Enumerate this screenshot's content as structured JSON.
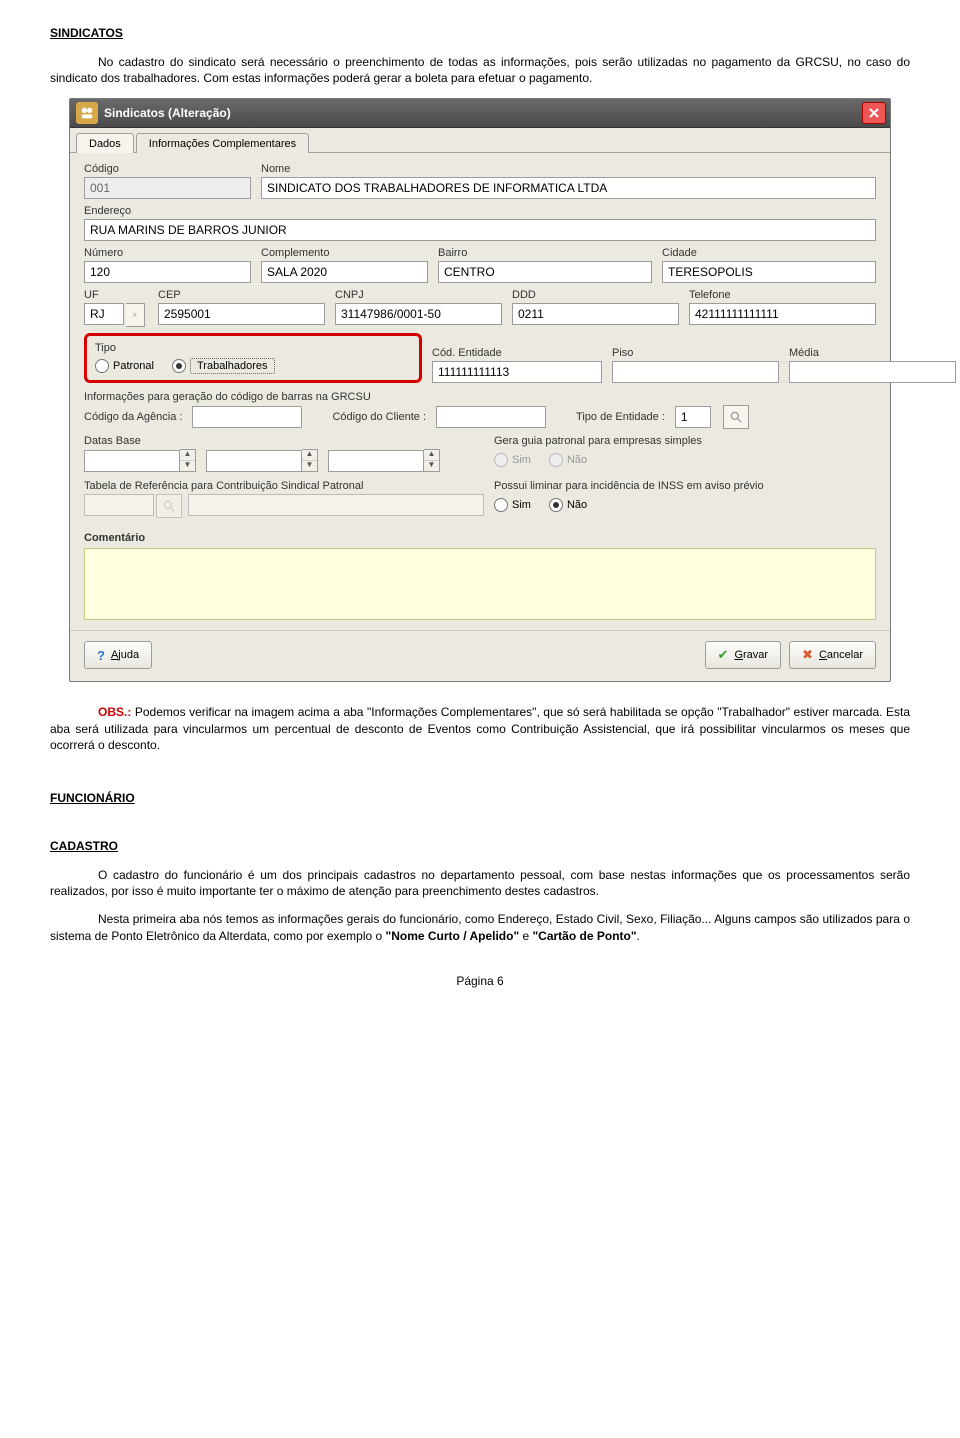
{
  "headings": {
    "sindicatos": "SINDICATOS",
    "funcionario": "FUNCIONÁRIO",
    "cadastro": "CADASTRO"
  },
  "paras": {
    "p1": "No cadastro do sindicato será necessário o preenchimento de todas as informações, pois serão utilizadas no pagamento da GRCSU, no caso do sindicato dos trabalhadores. Com estas informações poderá gerar a boleta para efetuar o pagamento.",
    "obs_prefix": "OBS.:",
    "obs_rest": " Podemos verificar na imagem acima a aba \"Informações Complementares\", que só será habilitada se opção \"Trabalhador\" estiver marcada. Esta aba será utilizada para vincularmos um percentual de desconto de Eventos como Contribuição Assistencial, que irá possibilitar vincularmos os meses que ocorrerá o desconto.",
    "p2": "O cadastro do funcionário é um dos principais cadastros no departamento pessoal, com base nestas informações que os processamentos serão realizados, por isso é muito importante ter o máximo de atenção para preenchimento destes cadastros.",
    "p3a": "Nesta primeira aba nós temos as informações gerais do funcionário, como Endereço, Estado Civil, Sexo, Filiação... Alguns campos são utilizados para o sistema de Ponto Eletrônico da Alterdata, como por exemplo o ",
    "p3b": "\"Nome Curto / Apelido\"",
    "p3c": " e ",
    "p3d": "\"Cartão de Ponto\"",
    "p3e": "."
  },
  "footer": "Página 6",
  "win": {
    "title": "Sindicatos (Alteração)",
    "tabs": {
      "t1": "Dados",
      "t2": "Informações Complementares"
    },
    "labels": {
      "codigo": "Código",
      "nome": "Nome",
      "endereco": "Endereço",
      "numero": "Número",
      "complemento": "Complemento",
      "bairro": "Bairro",
      "cidade": "Cidade",
      "uf": "UF",
      "cep": "CEP",
      "cnpj": "CNPJ",
      "ddd": "DDD",
      "telefone": "Telefone",
      "tipo": "Tipo",
      "patronal": "Patronal",
      "trabalhadores": "Trabalhadores",
      "cod_entidade": "Cód. Entidade",
      "piso": "Piso",
      "media": "Média",
      "info_grcsu": "Informações para geração do código de barras na GRCSU",
      "cod_agencia": "Código da Agência :",
      "cod_cliente": "Código do Cliente :",
      "tipo_entidade": "Tipo de Entidade :",
      "datas_base": "Datas Base",
      "gera_guia": "Gera guia patronal para empresas simples",
      "sim": "Sim",
      "nao": "Não",
      "tabela_ref": "Tabela de Referência para Contribuição Sindical Patronal",
      "liminar": "Possui liminar para incidência de INSS em aviso prévio",
      "comentario": "Comentário"
    },
    "values": {
      "codigo": "001",
      "nome": "SINDICATO DOS TRABALHADORES DE INFORMATICA LTDA",
      "endereco": "RUA MARINS DE BARROS JUNIOR",
      "numero": "120",
      "complemento": "SALA 2020",
      "bairro": "CENTRO",
      "cidade": "TERESOPOLIS",
      "uf": "RJ",
      "cep": "2595001",
      "cnpj": "31147986/0001-50",
      "ddd": "0211",
      "telefone": "42111111111111",
      "cod_entidade": "111111111113",
      "tipo_entidade": "1"
    },
    "buttons": {
      "ajuda": "Ajuda",
      "gravar": "Gravar",
      "cancelar": "Cancelar"
    }
  }
}
